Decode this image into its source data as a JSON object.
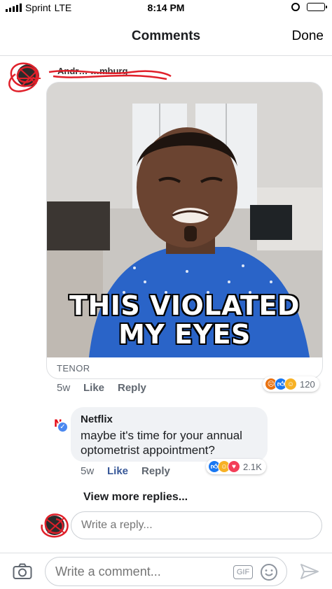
{
  "status_bar": {
    "carrier": "Sprint",
    "network": "LTE",
    "time": "8:14 PM"
  },
  "header": {
    "title": "Comments",
    "done_label": "Done"
  },
  "comment": {
    "author": "Andr… …mburg",
    "gif_caption_line1": "THIS VIOLATED",
    "gif_caption_line2": "MY EYES",
    "gif_source": "TENOR",
    "age": "5w",
    "like_label": "Like",
    "reply_label": "Reply",
    "reaction_count": "120",
    "reactions": [
      "angry",
      "like",
      "haha"
    ]
  },
  "reply": {
    "author": "Netflix",
    "text": "maybe it's time for your annual optometrist appointment?",
    "age": "5w",
    "like_label": "Like",
    "reply_label": "Reply",
    "reaction_count": "2.1K",
    "reactions": [
      "like",
      "haha",
      "love"
    ]
  },
  "view_more_label": "View more replies...",
  "reply_input": {
    "placeholder": "Write a reply..."
  },
  "composer": {
    "placeholder": "Write a comment...",
    "gif_label": "GIF"
  },
  "colors": {
    "like_blue": "#385898",
    "reaction_like": "#1877f2",
    "reaction_love": "#f33e58",
    "reaction_haha": "#f7b125",
    "reaction_angry": "#e9710f",
    "netflix_red": "#e50914"
  }
}
